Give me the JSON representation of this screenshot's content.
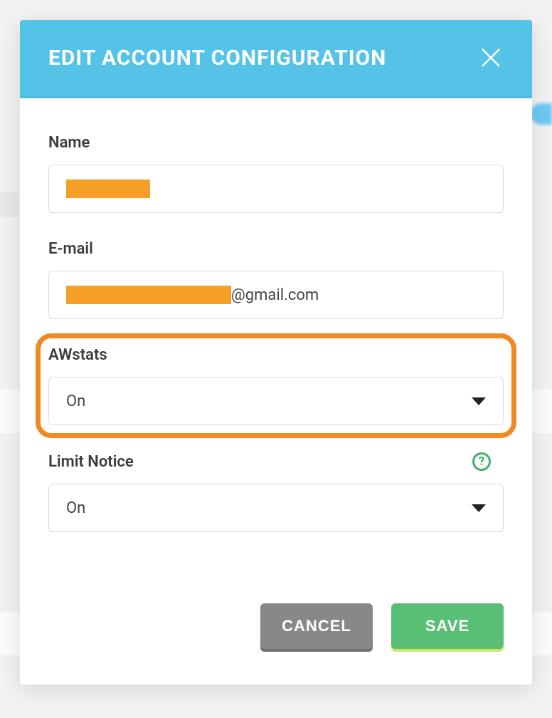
{
  "modal": {
    "title": "EDIT ACCOUNT CONFIGURATION",
    "fields": {
      "name": {
        "label": "Name",
        "redacted": true
      },
      "email": {
        "label": "E-mail",
        "suffix": "@gmail.com",
        "redacted": true
      },
      "awstats": {
        "label": "AWstats",
        "value": "On"
      },
      "limit_notice": {
        "label": "Limit Notice",
        "value": "On"
      }
    },
    "buttons": {
      "cancel": "CANCEL",
      "save": "SAVE"
    }
  },
  "highlight": {
    "target": "awstats"
  },
  "icons": {
    "close": "close-icon",
    "help": "?",
    "caret": "chevron-down-icon"
  }
}
